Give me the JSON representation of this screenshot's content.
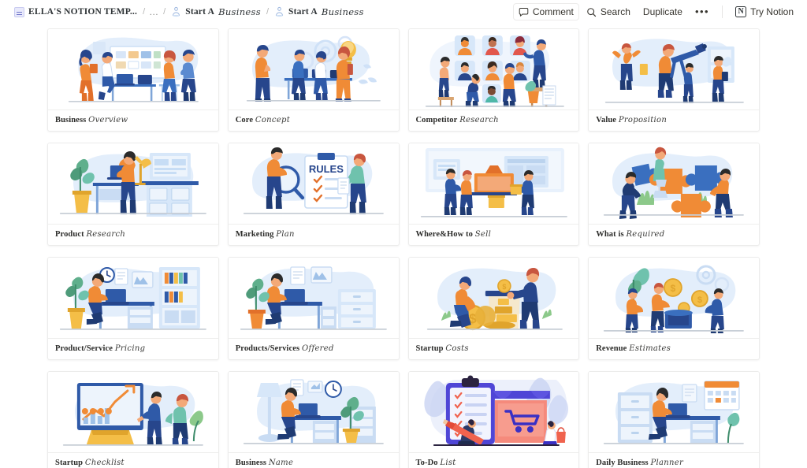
{
  "breadcrumb": {
    "root": {
      "label": "ELLA'S NOTION TEMP...",
      "icon": "page-icon"
    },
    "sep": "/",
    "ellipsis": "…",
    "items": [
      {
        "icon": "person-icon",
        "bold": "Start A",
        "italic": "Business"
      },
      {
        "icon": "person-icon",
        "bold": "Start A",
        "italic": "Business"
      }
    ]
  },
  "actions": {
    "comment": {
      "label": "Comment",
      "icon": "comment-icon"
    },
    "search": {
      "label": "Search",
      "icon": "search-icon"
    },
    "duplicate": {
      "label": "Duplicate"
    },
    "more": {
      "label": "•••",
      "icon": "more-dots-icon"
    },
    "try_notion": {
      "label": "Try Notion",
      "icon": "notion-logo-icon"
    }
  },
  "colors": {
    "orange": "#F08B36",
    "orange_dark": "#E2702A",
    "blue": "#3A6FBF",
    "blue_dark": "#27468C",
    "navy": "#1F3B73",
    "blob": "#E3EEFB",
    "blob_soft": "#EFF5FD",
    "gold": "#F4BE47",
    "gold_dark": "#E0A42C",
    "purple": "#4F46D6",
    "coral": "#F58A7C",
    "green": "#8CC98A",
    "card_border": "#ECECEB",
    "text": "#2C2C2A"
  },
  "cards": [
    {
      "bold": "Business",
      "italic": "Overview",
      "art": "meeting-whiteboard"
    },
    {
      "bold": "Core",
      "italic": "Concept",
      "art": "idea-lightbulb"
    },
    {
      "bold": "Competitor",
      "italic": "Research",
      "art": "avatar-grid"
    },
    {
      "bold": "Value",
      "italic": "Proposition",
      "art": "telescope-vision"
    },
    {
      "bold": "Product",
      "italic": "Research",
      "art": "desk-plant-laptop"
    },
    {
      "bold": "Marketing",
      "italic": "Plan",
      "art": "rules-checklist"
    },
    {
      "bold": "Where&How to",
      "italic": "Sell",
      "art": "storefront-sell"
    },
    {
      "bold": "What is",
      "italic": "Required",
      "art": "puzzle-pieces"
    },
    {
      "bold": "Product/Service",
      "italic": "Pricing",
      "art": "office-shelf-desk"
    },
    {
      "bold": "Products/Services",
      "italic": "Offered",
      "art": "desk-files"
    },
    {
      "bold": "Startup",
      "italic": "Costs",
      "art": "coins-jar"
    },
    {
      "bold": "Revenue",
      "italic": "Estimates",
      "art": "coins-growth"
    },
    {
      "bold": "Startup",
      "italic": "Checklist",
      "art": "chart-presentation"
    },
    {
      "bold": "Business",
      "italic": "Name",
      "art": "lamp-desk-work"
    },
    {
      "bold": "To-Do",
      "italic": "List",
      "art": "clipboard-cart"
    },
    {
      "bold": "Daily Business",
      "italic": "Planner",
      "art": "cabinet-calendar"
    }
  ]
}
